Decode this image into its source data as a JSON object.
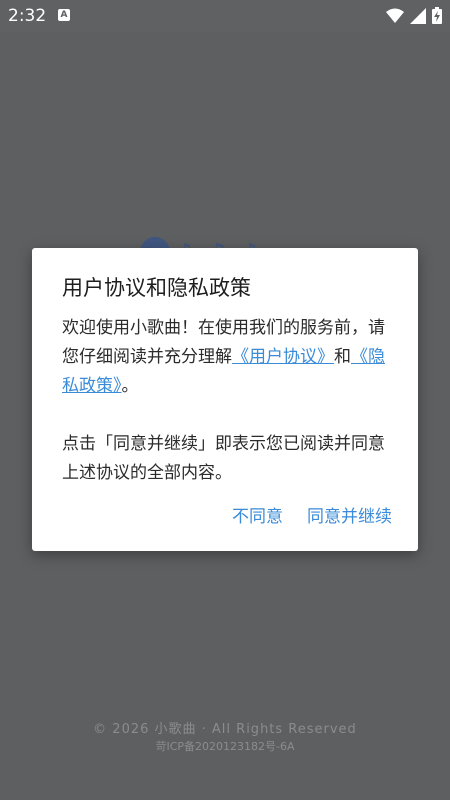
{
  "status_bar": {
    "time": "2:32",
    "notification_badge": "A",
    "icons": [
      "wifi-icon",
      "signal-icon",
      "battery-charging-icon"
    ]
  },
  "splash": {
    "copyright": "© 2026 小歌曲 · All Rights Reserved",
    "icp": "苛ICP备2020123182号-6A"
  },
  "dialog": {
    "title": "用户协议和隐私政策",
    "intro": "欢迎使用小歌曲！在使用我们的服务前，请您仔细阅读并充分理解",
    "user_agreement_link": "《用户协议》",
    "and_text": "和",
    "privacy_policy_link": "《隐私政策》",
    "period": "。",
    "consent_note": "点击「同意并继续」即表示您已阅读并同意上述协议的全部内容。",
    "disagree_label": "不同意",
    "agree_label": "同意并继续"
  },
  "colors": {
    "accent": "#3a8bd8",
    "overlay": "#5d5f61",
    "dialog_bg": "#ffffff"
  }
}
